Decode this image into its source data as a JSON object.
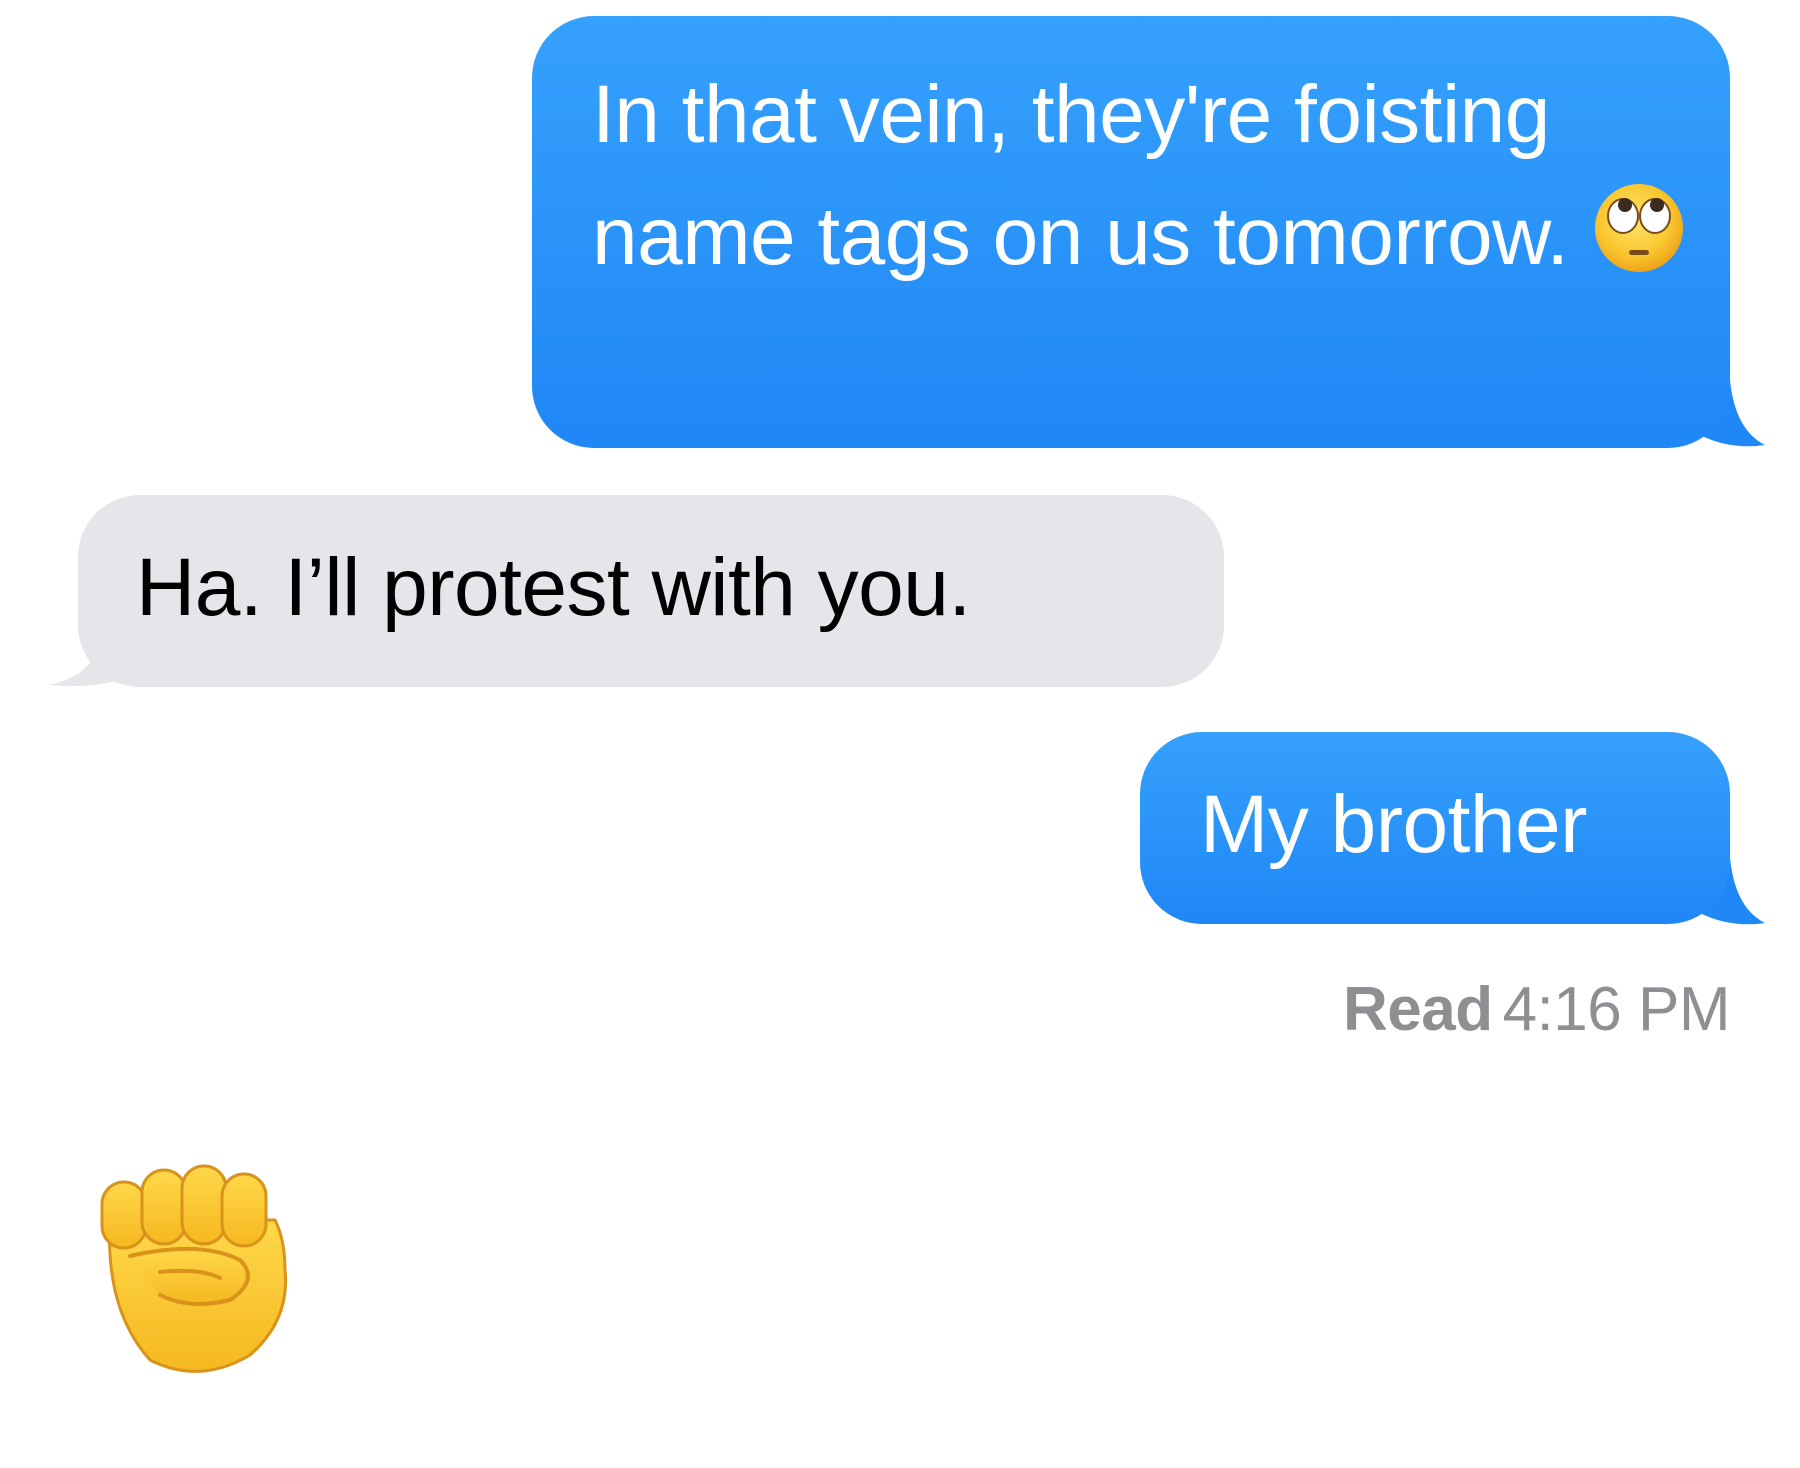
{
  "conversation": {
    "messages": [
      {
        "direction": "sent",
        "text": "In that vein, they're foisting name tags on us tomorrow.",
        "emoji": "face-with-rolling-eyes-icon"
      },
      {
        "direction": "received",
        "text": "Ha. I’ll protest with you."
      },
      {
        "direction": "sent",
        "text": "My brother"
      }
    ],
    "read_receipt": {
      "label": "Read",
      "time": "4:16 PM"
    },
    "reaction_emoji": "raised-fist-icon"
  },
  "colors": {
    "sent_bubble": "#1f87f6",
    "received_bubble": "#e5e5ea",
    "sent_text": "#ffffff",
    "received_text": "#000000",
    "receipt_text": "#8e8e93",
    "emoji_yellow": "#f8c230"
  }
}
